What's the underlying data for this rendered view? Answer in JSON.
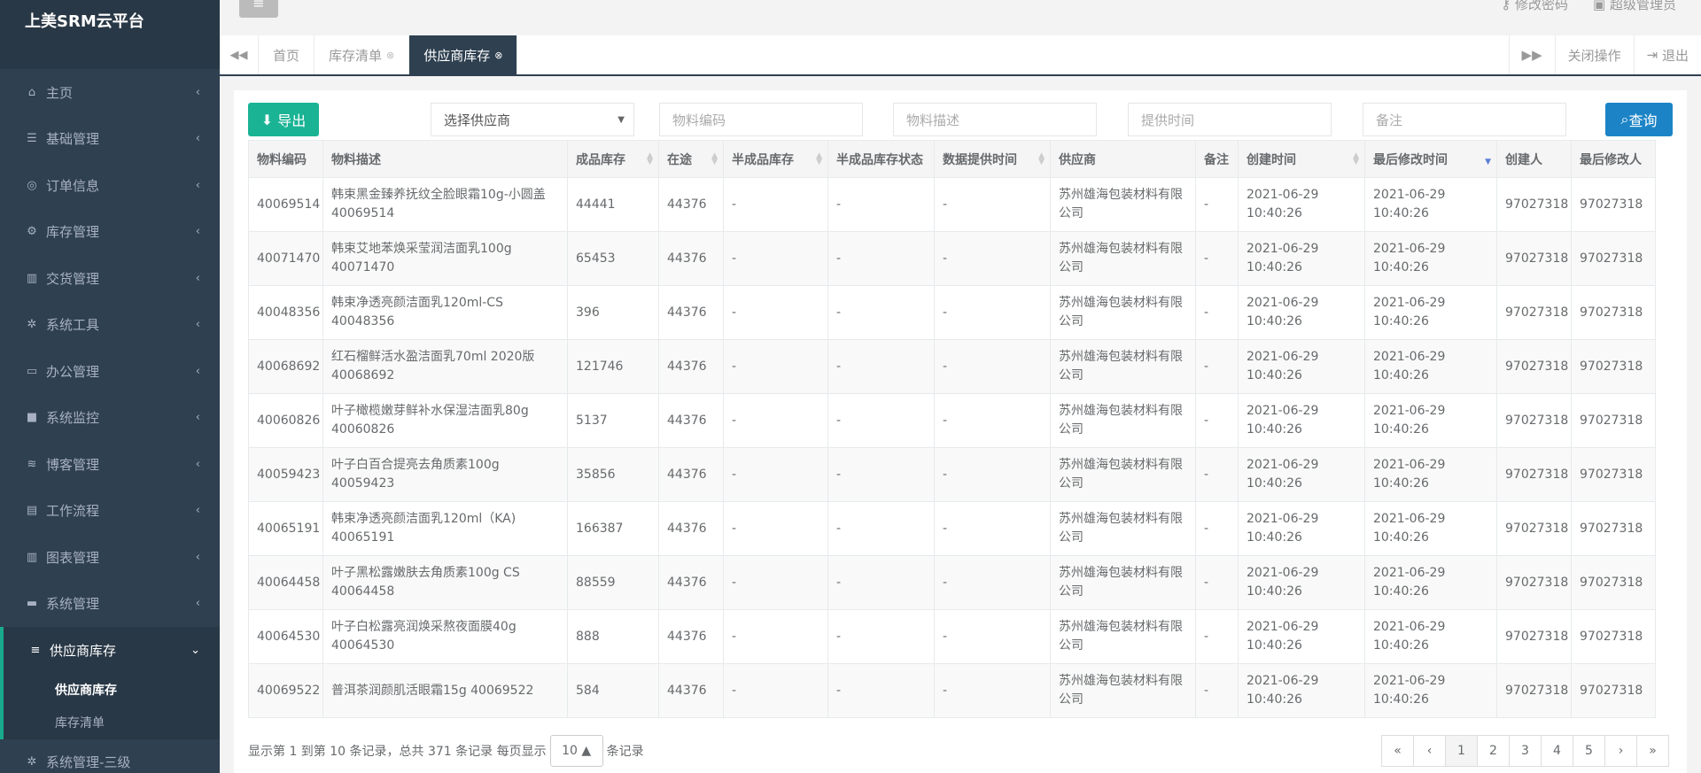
{
  "app": {
    "title": "上美SRM云平台"
  },
  "sidebar": {
    "items": [
      {
        "label": "主页",
        "icon": "home-icon",
        "glyph": "⌂"
      },
      {
        "label": "基础管理",
        "icon": "list-icon",
        "glyph": "☰"
      },
      {
        "label": "订单信息",
        "icon": "globe-icon",
        "glyph": "◎"
      },
      {
        "label": "库存管理",
        "icon": "cubes-icon",
        "glyph": "⚙"
      },
      {
        "label": "交货管理",
        "icon": "bar-chart-icon",
        "glyph": "▥"
      },
      {
        "label": "系统工具",
        "icon": "cog-icon",
        "glyph": "✲"
      },
      {
        "label": "办公管理",
        "icon": "laptop-icon",
        "glyph": "▭"
      },
      {
        "label": "系统监控",
        "icon": "video-icon",
        "glyph": "■"
      },
      {
        "label": "博客管理",
        "icon": "rss-icon",
        "glyph": "≋"
      },
      {
        "label": "工作流程",
        "icon": "print-icon",
        "glyph": "▤"
      },
      {
        "label": "图表管理",
        "icon": "chart-icon",
        "glyph": "▥"
      },
      {
        "label": "系统管理",
        "icon": "desktop-icon",
        "glyph": "▬"
      },
      {
        "label": "供应商库存",
        "icon": "database-icon",
        "glyph": "≡"
      }
    ],
    "submenu": [
      "供应商库存",
      "库存清单"
    ],
    "more": "系统管理-三级"
  },
  "header": {
    "change_password": "修改密码",
    "user": "超级管理员"
  },
  "tabs": {
    "items": [
      "首页",
      "库存清单",
      "供应商库存"
    ],
    "close_ops": "关闭操作",
    "logout": "退出"
  },
  "filters": {
    "export": "导出",
    "supplier": "选择供应商",
    "material_code": "物料编码",
    "material_desc": "物料描述",
    "provide_time": "提供时间",
    "remark": "备注",
    "query": "查询"
  },
  "table": {
    "headers": [
      "物料编码",
      "物料描述",
      "成品库存",
      "在途",
      "半成品库存",
      "半成品库存状态",
      "数据提供时间",
      "供应商",
      "备注",
      "创建时间",
      "最后修改时间",
      "创建人",
      "最后修改人"
    ],
    "rows": [
      [
        "40069514",
        "韩束黑金臻养抚纹全脸眼霜10g-小圆盖 40069514",
        "44441",
        "44376",
        "-",
        "-",
        "-",
        "苏州雄海包装材料有限公司",
        "-",
        "2021-06-29 10:40:26",
        "2021-06-29 10:40:26",
        "97027318",
        "97027318"
      ],
      [
        "40071470",
        "韩束艾地苯焕采莹润洁面乳100g 40071470",
        "65453",
        "44376",
        "-",
        "-",
        "-",
        "苏州雄海包装材料有限公司",
        "-",
        "2021-06-29 10:40:26",
        "2021-06-29 10:40:26",
        "97027318",
        "97027318"
      ],
      [
        "40048356",
        "韩束净透亮颜洁面乳120ml-CS 40048356",
        "396",
        "44376",
        "-",
        "-",
        "-",
        "苏州雄海包装材料有限公司",
        "-",
        "2021-06-29 10:40:26",
        "2021-06-29 10:40:26",
        "97027318",
        "97027318"
      ],
      [
        "40068692",
        "红石榴鲜活水盈洁面乳70ml 2020版 40068692",
        "121746",
        "44376",
        "-",
        "-",
        "-",
        "苏州雄海包装材料有限公司",
        "-",
        "2021-06-29 10:40:26",
        "2021-06-29 10:40:26",
        "97027318",
        "97027318"
      ],
      [
        "40060826",
        "叶子橄榄嫩芽鲜补水保湿洁面乳80g 40060826",
        "5137",
        "44376",
        "-",
        "-",
        "-",
        "苏州雄海包装材料有限公司",
        "-",
        "2021-06-29 10:40:26",
        "2021-06-29 10:40:26",
        "97027318",
        "97027318"
      ],
      [
        "40059423",
        "叶子白百合提亮去角质素100g 40059423",
        "35856",
        "44376",
        "-",
        "-",
        "-",
        "苏州雄海包装材料有限公司",
        "-",
        "2021-06-29 10:40:26",
        "2021-06-29 10:40:26",
        "97027318",
        "97027318"
      ],
      [
        "40065191",
        "韩束净透亮颜洁面乳120ml（KA) 40065191",
        "166387",
        "44376",
        "-",
        "-",
        "-",
        "苏州雄海包装材料有限公司",
        "-",
        "2021-06-29 10:40:26",
        "2021-06-29 10:40:26",
        "97027318",
        "97027318"
      ],
      [
        "40064458",
        "叶子黑松露嫩肤去角质素100g CS 40064458",
        "88559",
        "44376",
        "-",
        "-",
        "-",
        "苏州雄海包装材料有限公司",
        "-",
        "2021-06-29 10:40:26",
        "2021-06-29 10:40:26",
        "97027318",
        "97027318"
      ],
      [
        "40064530",
        "叶子白松露亮润焕采熬夜面膜40g 40064530",
        "888",
        "44376",
        "-",
        "-",
        "-",
        "苏州雄海包装材料有限公司",
        "-",
        "2021-06-29 10:40:26",
        "2021-06-29 10:40:26",
        "97027318",
        "97027318"
      ],
      [
        "40069522",
        "普洱茶润颜肌活眼霜15g 40069522",
        "584",
        "44376",
        "-",
        "-",
        "-",
        "苏州雄海包装材料有限公司",
        "-",
        "2021-06-29 10:40:26",
        "2021-06-29 10:40:26",
        "97027318",
        "97027318"
      ]
    ]
  },
  "footer": {
    "info": "显示第 1 到第 10 条记录，总共 371 条记录 每页显示",
    "page_size": "10",
    "suffix": "条记录",
    "pager": [
      "«",
      "‹",
      "1",
      "2",
      "3",
      "4",
      "5",
      "›",
      "»"
    ]
  },
  "colors": {
    "sidebar": "#2f4050",
    "accent_green": "#1ab394",
    "accent_blue": "#1c84c6"
  }
}
